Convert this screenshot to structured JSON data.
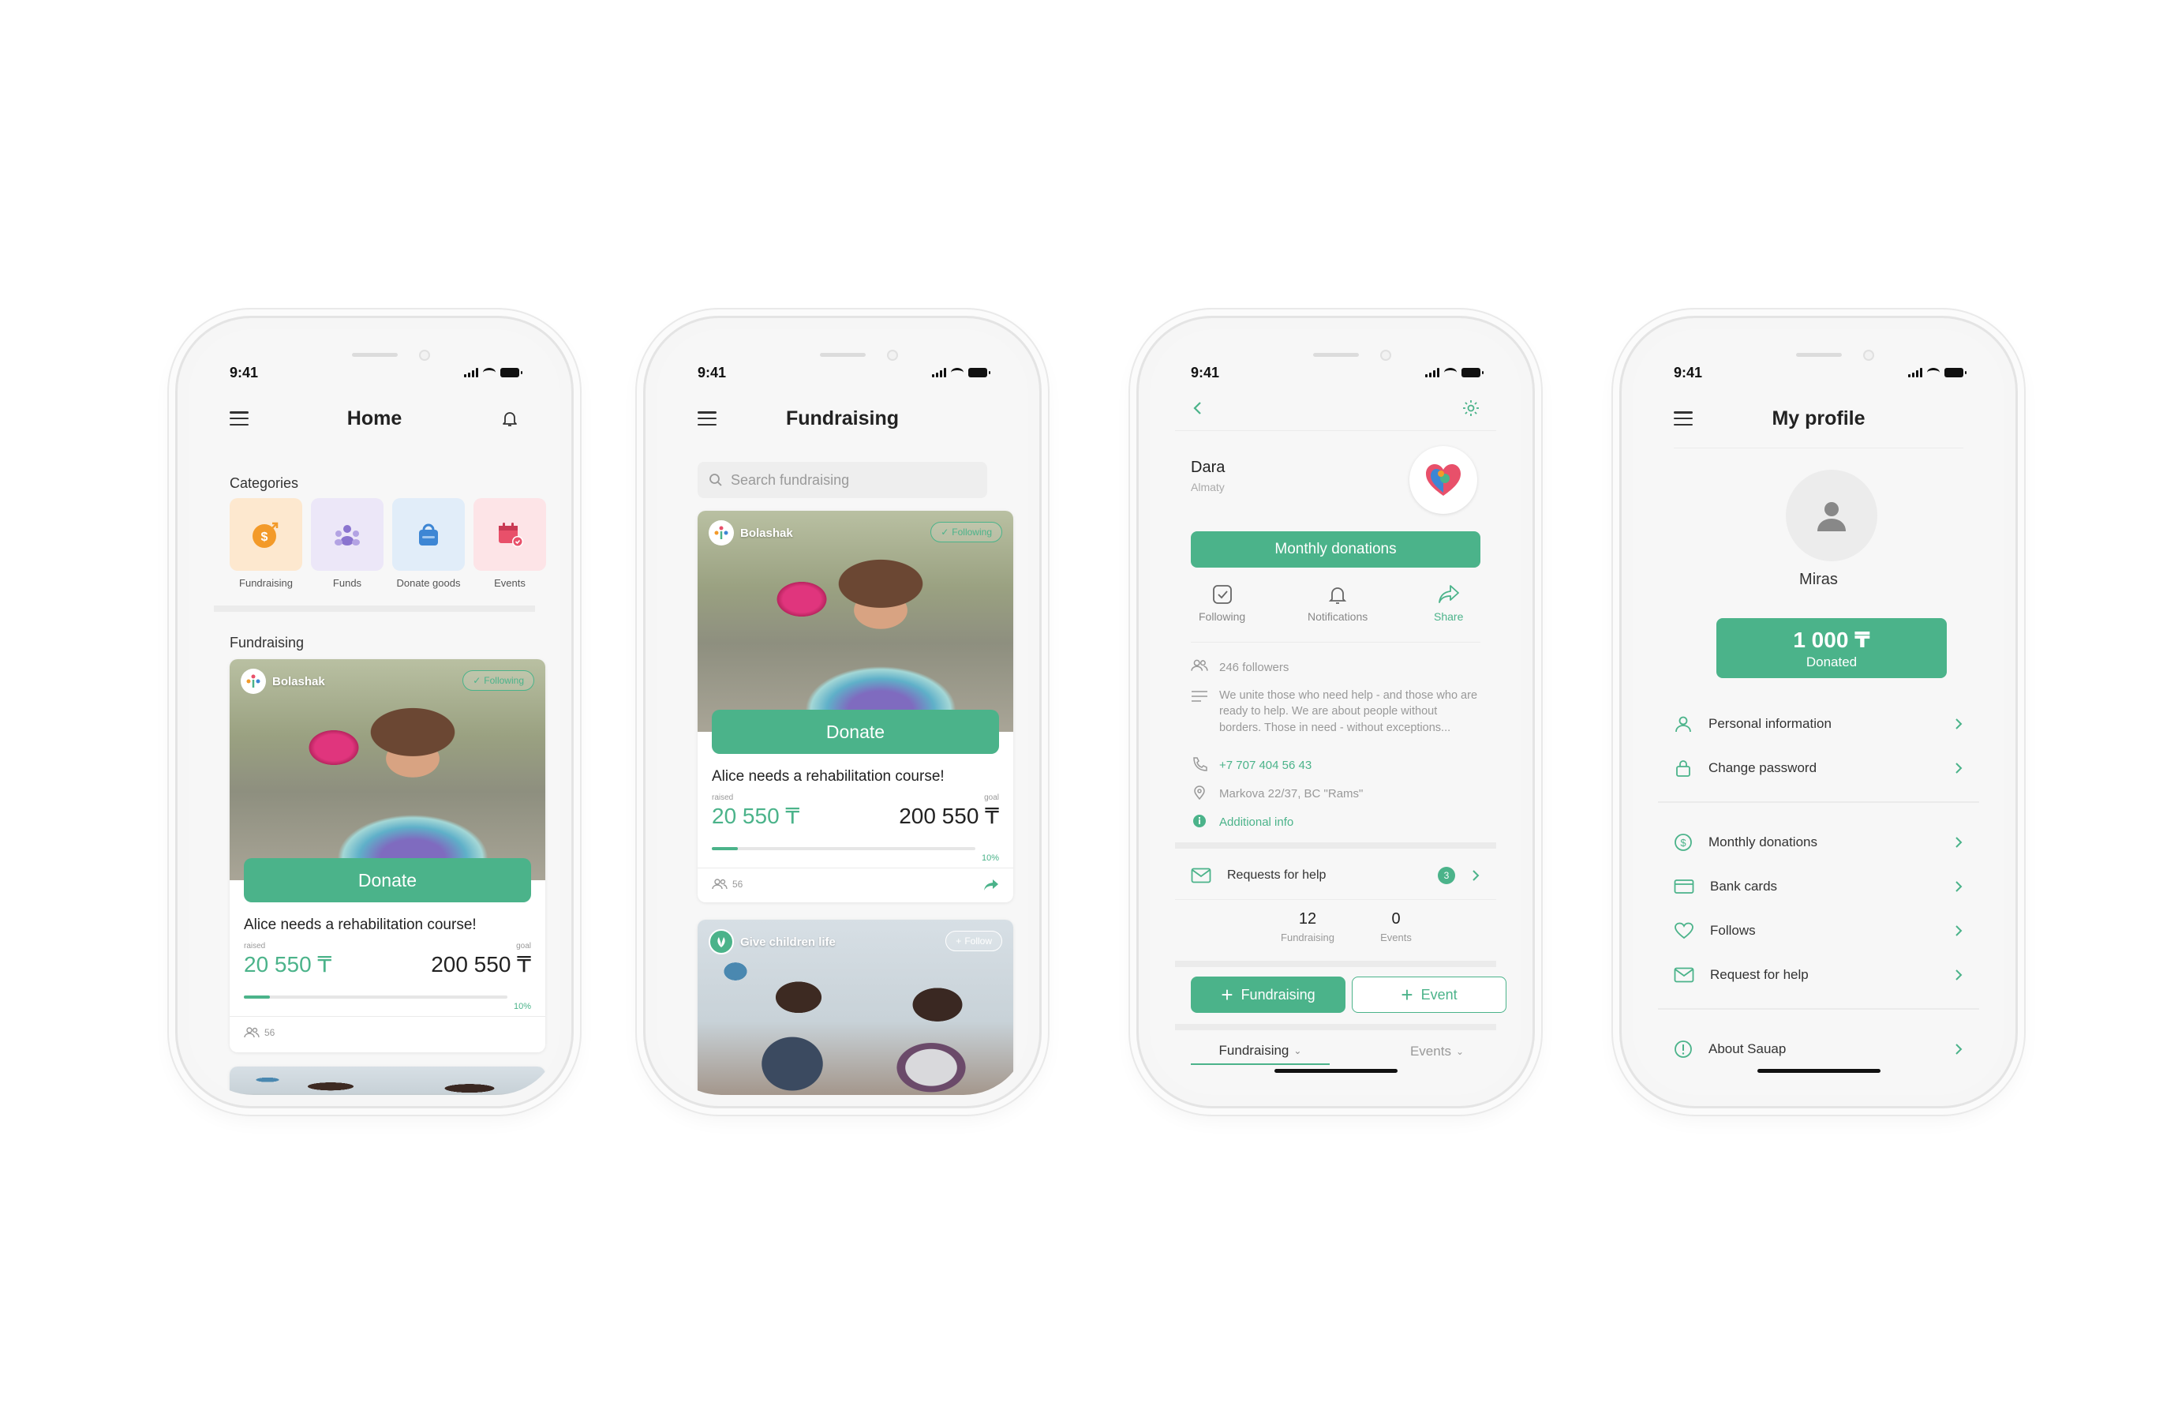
{
  "status": {
    "time": "9:41"
  },
  "home": {
    "title": "Home",
    "categories_label": "Categories",
    "categories": [
      {
        "label": "Fundraising",
        "icon": "coin-icon",
        "bg": "#fde8cf",
        "color": "#f39a29"
      },
      {
        "label": "Funds",
        "icon": "people-icon",
        "bg": "#ece7f8",
        "color": "#8a74cf"
      },
      {
        "label": "Donate goods",
        "icon": "bag-icon",
        "bg": "#e1edf9",
        "color": "#3d86d4"
      },
      {
        "label": "Events",
        "icon": "calendar-icon",
        "bg": "#fde4e7",
        "color": "#e8506a"
      }
    ],
    "fundraising_label": "Fundraising"
  },
  "campaign": {
    "org": "Bolashak",
    "following": "Following",
    "donate": "Donate",
    "title": "Alice needs a rehabilitation course!",
    "raised_label": "raised",
    "goal_label": "goal",
    "raised": "20 550 ₸",
    "goal": "200 550 ₸",
    "percent_label": "10%",
    "progress": 0.1,
    "participants": "56"
  },
  "fundraising": {
    "title": "Fundraising",
    "search_placeholder": "Search fundraising",
    "second_org": "Give children life",
    "follow": "Follow"
  },
  "fund": {
    "name": "Dara",
    "city": "Almaty",
    "monthly": "Monthly donations",
    "actions": [
      {
        "label": "Following",
        "icon": "check-square-icon"
      },
      {
        "label": "Notifications",
        "icon": "bell-icon"
      },
      {
        "label": "Share",
        "icon": "share-icon"
      }
    ],
    "followers": "246 followers",
    "description": "We unite those who need help - and those who are ready to help. We are about people without borders. Those in need - without exceptions...",
    "phone": "+7 707 404 56 43",
    "address": "Markova 22/37, BC \"Rams\"",
    "additional": "Additional info",
    "requests": "Requests for help",
    "requests_count": "3",
    "stats": [
      {
        "value": "12",
        "label": "Fundraising"
      },
      {
        "value": "0",
        "label": "Events"
      }
    ],
    "btn_fundraising": "Fundraising",
    "btn_event": "Event",
    "tab_fundraising": "Fundraising",
    "tab_events": "Events"
  },
  "profile": {
    "title": "My profile",
    "name": "Miras",
    "donated_amount": "1 000 ₸",
    "donated_label": "Donated",
    "items_a": [
      {
        "label": "Personal information",
        "icon": "user-icon"
      },
      {
        "label": "Change password",
        "icon": "lock-icon"
      }
    ],
    "items_b": [
      {
        "label": "Monthly donations",
        "icon": "dollar-icon"
      },
      {
        "label": "Bank cards",
        "icon": "card-icon"
      },
      {
        "label": "Follows",
        "icon": "heart-icon"
      },
      {
        "label": "Request for help",
        "icon": "mail-icon"
      }
    ],
    "items_c": [
      {
        "label": "About Sauap",
        "icon": "info-icon"
      }
    ]
  },
  "colors": {
    "accent": "#4bb38a"
  }
}
